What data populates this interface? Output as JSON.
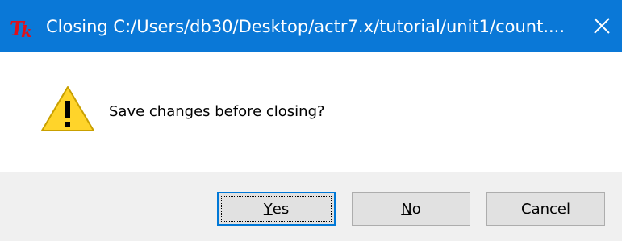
{
  "window": {
    "title": "Closing C:/Users/db30/Desktop/actr7.x/tutorial/unit1/count....",
    "app_icon": "tk-feather-icon",
    "titlebar_color": "#0a78d7",
    "close_icon": "close-icon"
  },
  "dialog": {
    "icon": "warning-icon",
    "icon_color": "#ffd42a",
    "message": "Save changes before closing?"
  },
  "buttons": {
    "yes": {
      "mnemonic": "Y",
      "rest": "es",
      "focused": true
    },
    "no": {
      "mnemonic": "N",
      "rest": "o"
    },
    "cancel": {
      "label": "Cancel"
    }
  },
  "logo_text": "Tk"
}
